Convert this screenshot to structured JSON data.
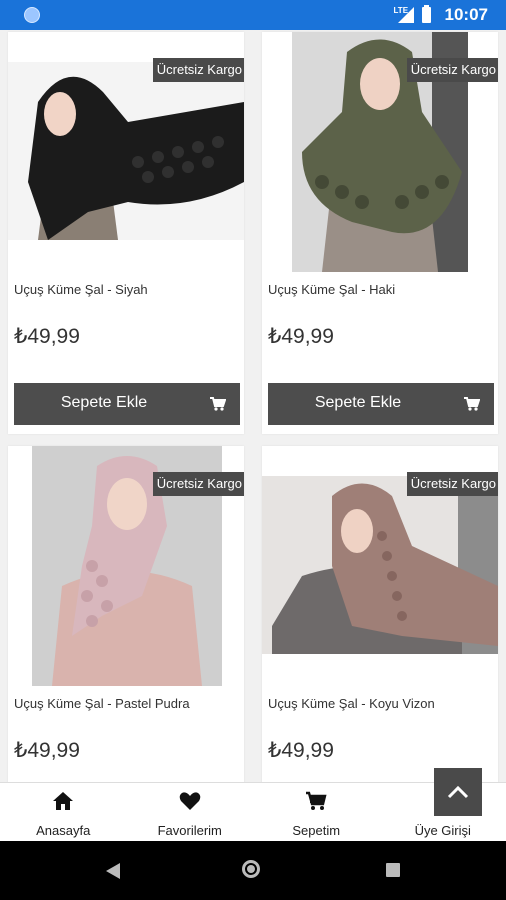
{
  "status_bar": {
    "time": "10:07",
    "network": "LTE"
  },
  "badge_text": "Ücretsiz Kargo",
  "add_to_cart_label": "Sepete Ekle",
  "products": [
    {
      "name": "Uçuş Küme Şal - Siyah",
      "price": "₺49,99",
      "scarf_color": "#1b1b1b",
      "garment_color": "#8a7f74"
    },
    {
      "name": "Uçuş Küme Şal - Haki",
      "price": "₺49,99",
      "scarf_color": "#5c6249",
      "garment_color": "#9a8f87"
    },
    {
      "name": "Uçuş Küme Şal - Pastel Pudra",
      "price": "₺49,99",
      "scarf_color": "#d8b7bd",
      "garment_color": "#d9b3ad"
    },
    {
      "name": "Uçuş Küme Şal - Koyu Vizon",
      "price": "₺49,99",
      "scarf_color": "#9f7f77",
      "garment_color": "#6e6a6a"
    }
  ],
  "bottom_nav": [
    {
      "label": "Anasayfa",
      "icon": "home-icon"
    },
    {
      "label": "Favorilerim",
      "icon": "heart-icon"
    },
    {
      "label": "Sepetim",
      "icon": "cart-icon"
    },
    {
      "label": "Üye Girişi",
      "icon": "user-icon"
    }
  ],
  "colors": {
    "status_bar": "#1a73d9",
    "button": "#4d4d4d",
    "badge": "#4a4a4a"
  }
}
